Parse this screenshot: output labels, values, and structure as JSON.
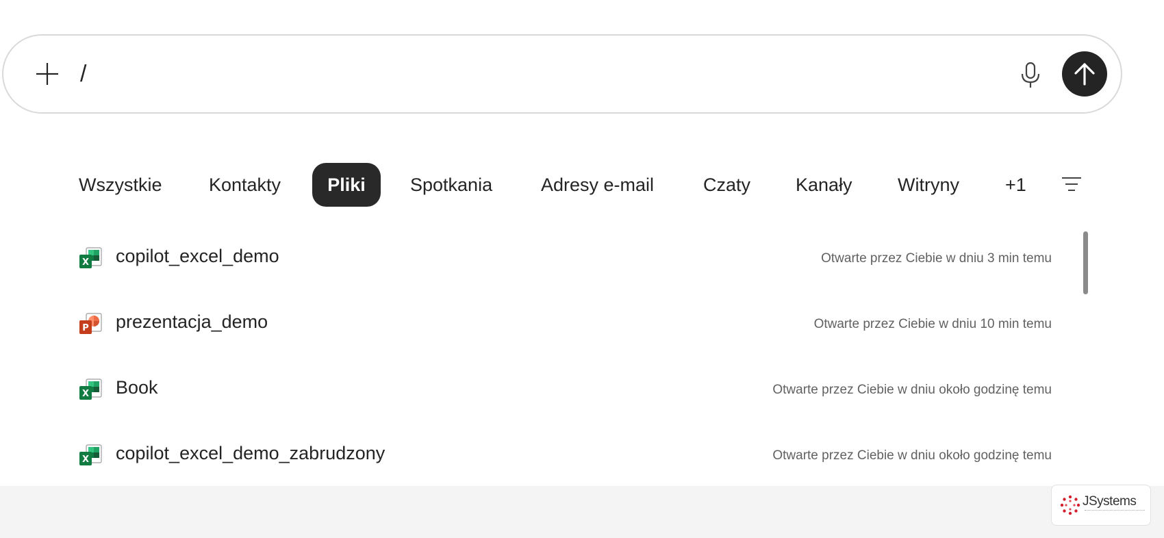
{
  "prompt": {
    "value": "/",
    "plus_icon": "plus-icon",
    "mic_icon": "microphone-icon",
    "send_icon": "arrow-up-icon"
  },
  "tabs": [
    {
      "label": "Wszystkie",
      "active": false
    },
    {
      "label": "Kontakty",
      "active": false
    },
    {
      "label": "Pliki",
      "active": true
    },
    {
      "label": "Spotkania",
      "active": false
    },
    {
      "label": "Adresy e-mail",
      "active": false
    },
    {
      "label": "Czaty",
      "active": false
    },
    {
      "label": "Kanały",
      "active": false
    },
    {
      "label": "Witryny",
      "active": false
    },
    {
      "label": "+1",
      "active": false
    }
  ],
  "filter_icon": "filter-lines-icon",
  "files": [
    {
      "name": "copilot_excel_demo",
      "type": "excel",
      "meta": "Otwarte przez Ciebie w dniu 3 min temu"
    },
    {
      "name": "prezentacja_demo",
      "type": "powerpoint",
      "meta": "Otwarte przez Ciebie w dniu 10 min temu"
    },
    {
      "name": "Book",
      "type": "excel",
      "meta": "Otwarte przez Ciebie w dniu około godzinę temu"
    },
    {
      "name": "copilot_excel_demo_zabrudzony",
      "type": "excel",
      "meta": "Otwarte przez Ciebie w dniu około godzinę temu"
    }
  ],
  "brand": {
    "name": "JSystems"
  },
  "colors": {
    "active_tab_bg": "#292929",
    "send_button_bg": "#242424",
    "excel_green": "#107c41",
    "powerpoint_red": "#c43e1c",
    "brand_red": "#d3202c"
  }
}
